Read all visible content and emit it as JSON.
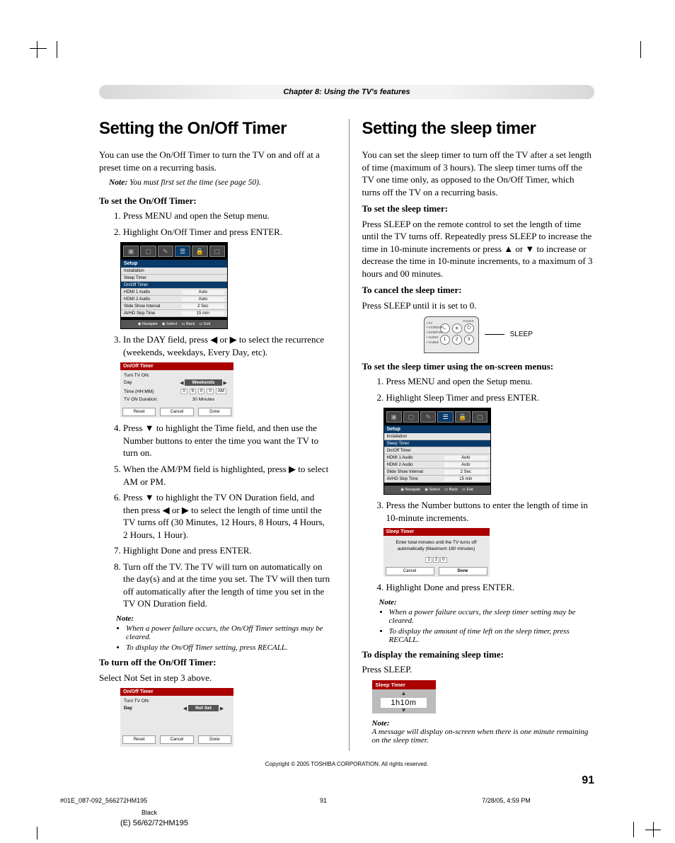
{
  "chapter_title": "Chapter 8: Using the TV's features",
  "page_number": "91",
  "copyright": "Copyright © 2005 TOSHIBA CORPORATION. All rights reserved.",
  "meta": {
    "file": "#01E_087-092_566272HM195",
    "page": "91",
    "date": "7/28/05, 4:59 PM",
    "color": "Black",
    "model": "(E) 56/62/72HM195"
  },
  "left": {
    "heading": "Setting the On/Off Timer",
    "intro": "You can use the On/Off Timer to turn the TV on and off at a preset time on a recurring basis.",
    "note1_label": "Note:",
    "note1_text": " You must first set the time (see page 50).",
    "sub1": "To set the On/Off Timer:",
    "steps1": [
      "Press MENU and open the Setup menu.",
      "Highlight On/Off Timer and press ENTER."
    ],
    "step3": "In the DAY field, press ◀ or ▶ to select the recurrence (weekends, weekdays, Every Day, etc).",
    "step4": "Press ▼ to highlight the Time field, and then use the Number buttons to enter the time you want the TV to turn on.",
    "step5": "When the AM/PM field is highlighted, press ▶ to select AM or PM.",
    "step6": "Press ▼ to highlight the TV ON Duration field, and then press ◀ or ▶ to select the length of time until the TV turns off (30 Minutes, 12 Hours, 8 Hours, 4 Hours, 2 Hours, 1 Hour).",
    "step7": "Highlight Done and press ENTER.",
    "step8": "Turn off the TV. The TV will turn on automatically on the day(s) and at the time you set. The TV will then turn off automatically after the length of time you set in the TV ON Duration field.",
    "note2_label": "Note:",
    "note2_items": [
      "When a power failure occurs, the On/Off Timer settings may be cleared.",
      "To display the On/Off Timer setting, press RECALL."
    ],
    "sub2": "To turn off the On/Off Timer:",
    "turn_off_text": "Select Not Set in step 3 above.",
    "osd1": {
      "head": "Setup",
      "rows": [
        {
          "l": "Installation",
          "r": ""
        },
        {
          "l": "Sleep Timer",
          "r": ""
        },
        {
          "l": "On/Off Timer",
          "r": "",
          "sel": true
        },
        {
          "l": "HDMI 1 Audio",
          "r": "Auto"
        },
        {
          "l": "HDMI 2 Audio",
          "r": "Auto"
        },
        {
          "l": "Slide Show Interval",
          "r": "2 Sec"
        },
        {
          "l": "AVHD Skip Time",
          "r": "15 min"
        }
      ],
      "footer": [
        "Navigate",
        "Select",
        "Back",
        "Exit"
      ]
    },
    "osd2": {
      "title": "On/Off Timer",
      "sub": "Turn TV ON:",
      "rows": [
        {
          "l": "Day",
          "val": "Weekends",
          "sel": true
        },
        {
          "l": "Time (HH:MM)",
          "cells": [
            "0",
            "9",
            "0",
            "0",
            "AM"
          ]
        },
        {
          "l": "TV ON Duration:",
          "plain": "30 Minutes"
        }
      ],
      "btns": [
        "Reset",
        "Cancel",
        "Done"
      ]
    },
    "osd3": {
      "title": "On/Off Timer",
      "sub": "Turn TV ON:",
      "rows": [
        {
          "l": "Day",
          "val": "Not Set",
          "sel": true
        }
      ],
      "btns": [
        "Reset",
        "Cancel",
        "Done"
      ]
    }
  },
  "right": {
    "heading": "Setting the sleep timer",
    "intro": "You can set the sleep timer to turn off the TV after a set length of time (maximum of 3 hours). The sleep timer turns off the TV one time only, as opposed to the On/Off Timer, which turns off the TV on a recurring basis.",
    "sub1": "To set the sleep timer:",
    "p1": "Press SLEEP on the remote control to set the length of time until the TV turns off. Repeatedly press SLEEP to increase the time in 10-minute increments or press ▲ or ▼ to increase or decrease the time in 10-minute increments, to a maximum of 3 hours and 00 minutes.",
    "sub2": "To cancel the sleep timer:",
    "p2": "Press SLEEP until it is set to 0.",
    "remote_label": "SLEEP",
    "remote_side": [
      "• TV",
      "• VCR/DVR",
      "• DVD/PVR",
      "• AUDIO",
      "• CABLE"
    ],
    "sub3": "To set the sleep timer using the on-screen menus:",
    "steps2": [
      "Press MENU and open the Setup menu.",
      "Highlight Sleep Timer and press ENTER."
    ],
    "step3b": "Press the Number buttons to enter the length of time in 10-minute increments.",
    "step4b": "Highlight Done and press ENTER.",
    "note3_label": "Note:",
    "note3_items": [
      "When a power failure occurs, the sleep timer setting may be cleared.",
      "To display the amount of time left on the sleep timer, press RECALL."
    ],
    "sub4": "To display the remaining sleep time:",
    "p4": "Press SLEEP.",
    "note4_label": "Note:",
    "note4_text": "A message will display on-screen when there is one minute remaining on the sleep timer.",
    "osd4": {
      "head": "Setup",
      "rows": [
        {
          "l": "Installation",
          "r": ""
        },
        {
          "l": "Sleep Timer",
          "r": "",
          "sel": true
        },
        {
          "l": "On/Off Timer",
          "r": ""
        },
        {
          "l": "HDMI 1 Audio",
          "r": "Auto"
        },
        {
          "l": "HDMI 2 Audio",
          "r": "Auto"
        },
        {
          "l": "Slide Show Interval",
          "r": "2 Sec"
        },
        {
          "l": "AVHD Skip Time",
          "r": "15 min"
        }
      ],
      "footer": [
        "Navigate",
        "Select",
        "Back",
        "Exit"
      ]
    },
    "osd5": {
      "title": "Sleep Timer",
      "msg": "Enter total minutes until the TV turns off automatically (Maximum 180 minutes)",
      "cells": [
        "1",
        "2",
        "0"
      ],
      "btns": [
        "Cancel",
        "Done"
      ]
    },
    "osd6": {
      "title": "Sleep Timer",
      "value": "1h10m"
    }
  }
}
